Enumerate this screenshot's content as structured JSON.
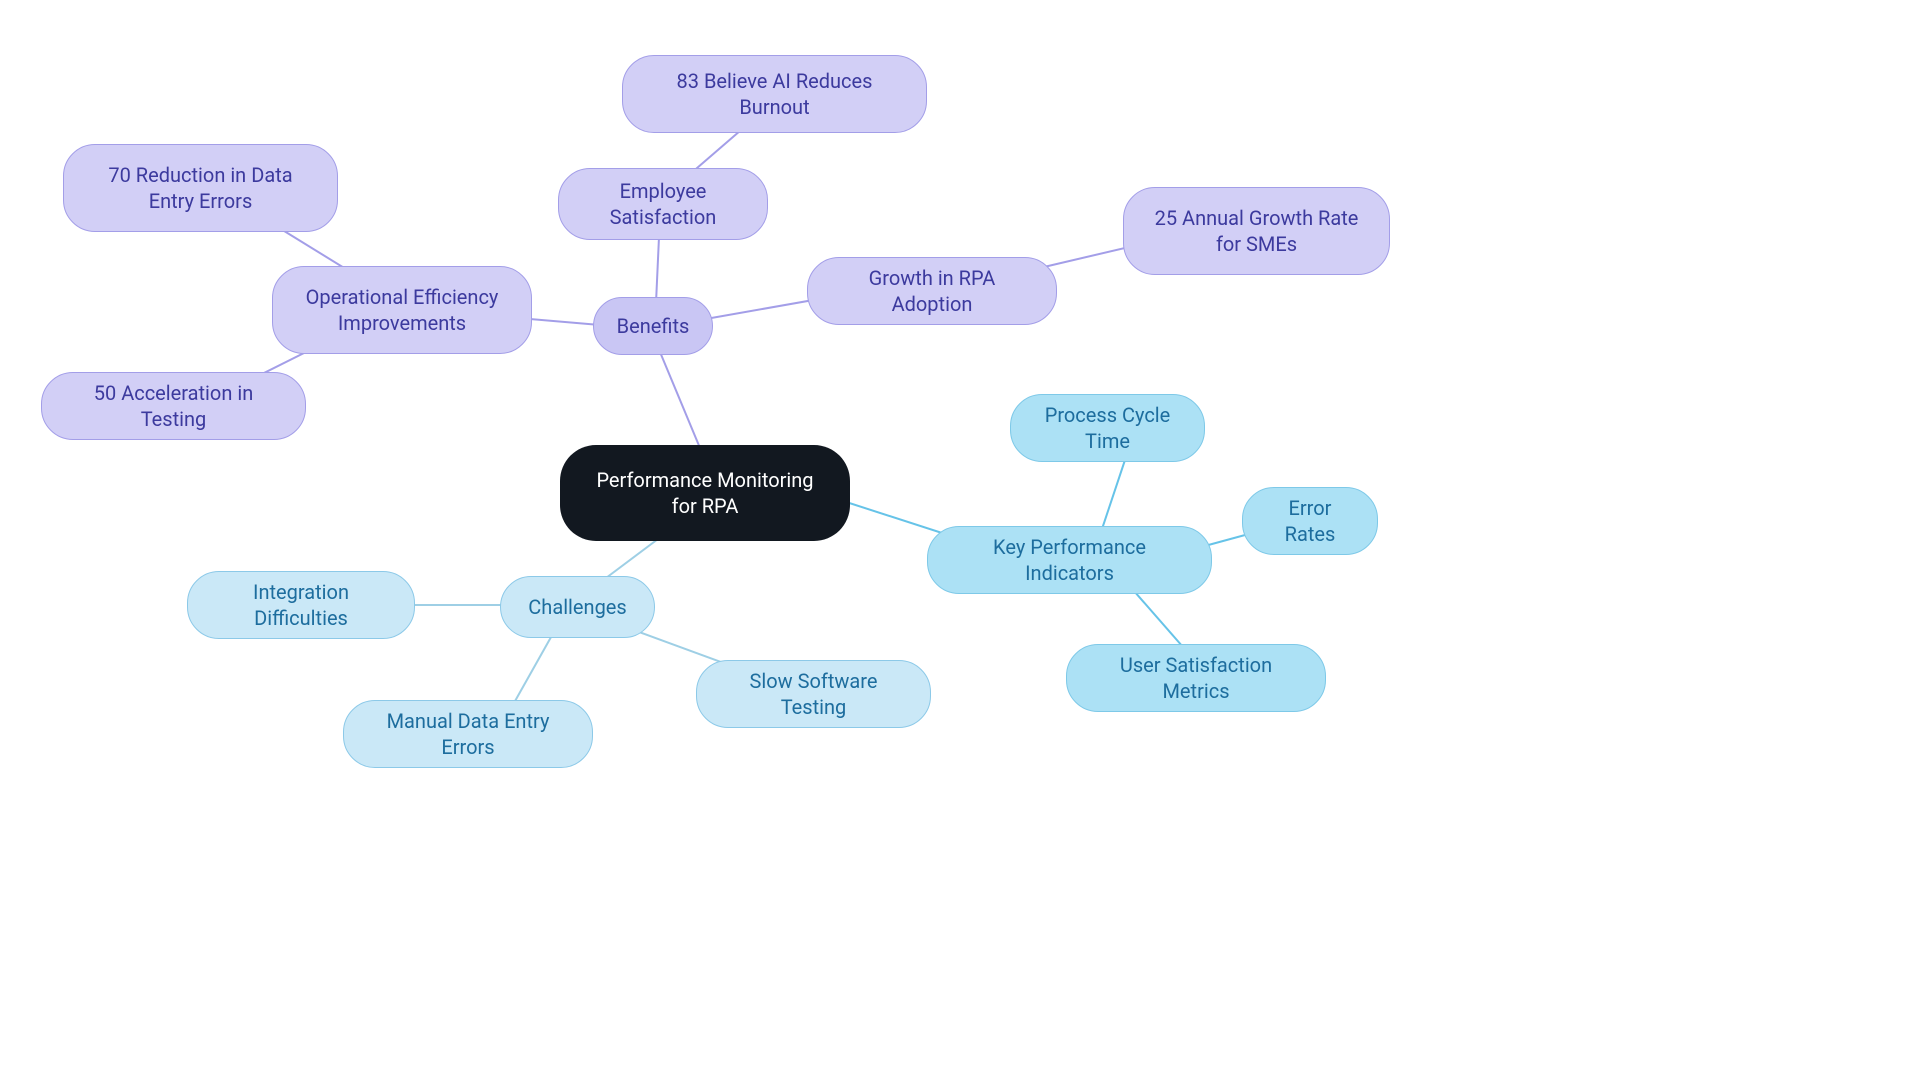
{
  "central": {
    "label": "Performance Monitoring for RPA"
  },
  "benefits": {
    "label": "Benefits",
    "opEff": {
      "label": "Operational Efficiency Improvements",
      "errors": "70 Reduction in Data Entry Errors",
      "testing": "50 Acceleration in Testing"
    },
    "empSat": {
      "label": "Employee Satisfaction",
      "burnout": "83 Believe AI Reduces Burnout"
    },
    "growth": {
      "label": "Growth in RPA Adoption",
      "rate": "25 Annual Growth Rate for SMEs"
    }
  },
  "kpi": {
    "label": "Key Performance Indicators",
    "cycle": "Process Cycle Time",
    "errors": "Error Rates",
    "user": "User Satisfaction Metrics"
  },
  "challenges": {
    "label": "Challenges",
    "integration": "Integration Difficulties",
    "manual": "Manual Data Entry Errors",
    "slow": "Slow Software Testing"
  },
  "colors": {
    "purpleLine": "#a39ee8",
    "blueKpiLine": "#66c3e8",
    "blueChallengeLine": "#9ecfe5"
  }
}
